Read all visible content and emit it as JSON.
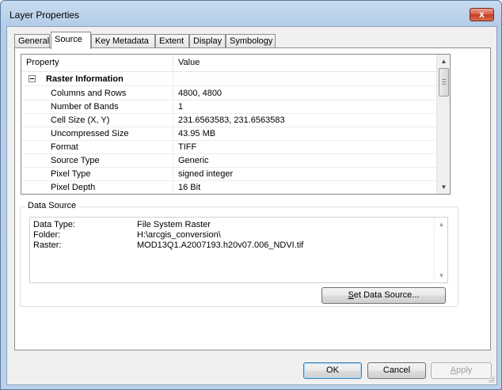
{
  "window": {
    "title": "Layer Properties",
    "close_glyph": "x"
  },
  "tabs": [
    {
      "label": "General",
      "active": false
    },
    {
      "label": "Source",
      "active": true
    },
    {
      "label": "Key Metadata",
      "active": false
    },
    {
      "label": "Extent",
      "active": false
    },
    {
      "label": "Display",
      "active": false
    },
    {
      "label": "Symbology",
      "active": false
    }
  ],
  "properties": {
    "header_property": "Property",
    "header_value": "Value",
    "section": "Raster Information",
    "rows": [
      {
        "property": "Columns and Rows",
        "value": "4800, 4800"
      },
      {
        "property": "Number of Bands",
        "value": "1"
      },
      {
        "property": "Cell Size (X, Y)",
        "value": "231.6563583, 231.6563583"
      },
      {
        "property": "Uncompressed Size",
        "value": "43.95 MB"
      },
      {
        "property": "Format",
        "value": "TIFF"
      },
      {
        "property": "Source Type",
        "value": "Generic"
      },
      {
        "property": "Pixel Type",
        "value": "signed integer"
      },
      {
        "property": "Pixel Depth",
        "value": "16 Bit"
      }
    ]
  },
  "data_source": {
    "label": "Data Source",
    "lines": [
      {
        "key": "Data Type:",
        "value": "File System Raster"
      },
      {
        "key": "Folder:",
        "value": "H:\\arcgis_conversion\\"
      },
      {
        "key": "Raster:",
        "value": "MOD13Q1.A2007193.h20v07.006_NDVI.tif"
      }
    ],
    "set_button_prefix": "",
    "set_button_mnemonic": "S",
    "set_button_rest": "et Data Source..."
  },
  "buttons": {
    "ok": "OK",
    "cancel": "Cancel",
    "apply_mnemonic": "A",
    "apply_rest": "pply"
  },
  "colors": {
    "title_bar": "#b9d1ea",
    "close_button": "#c13a21",
    "default_button_border": "#3c7fb1"
  }
}
